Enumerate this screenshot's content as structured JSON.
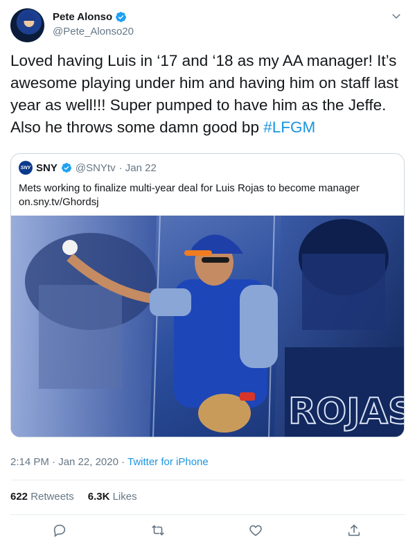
{
  "author": {
    "display_name": "Pete Alonso",
    "handle": "@Pete_Alonso20"
  },
  "tweet": {
    "text": "Loved having Luis in ‘17 and ‘18 as my AA manager! It’s awesome playing under him and having him on staff last year as well!!! Super pumped to have him as the Jeffe. Also he throws some damn good bp ",
    "hashtag": "#LFGM"
  },
  "quoted": {
    "logo_text": "SNY",
    "display_name": "SNY",
    "handle": "@SNYtv",
    "date": "· Jan 22",
    "text": "Mets working to finalize multi-year deal for Luis Rojas to become manager",
    "link": "on.sny.tv/Ghordsj",
    "image_jersey_text": "ROJAS"
  },
  "meta": {
    "time_date": "2:14 PM · Jan 22, 2020 · ",
    "source": "Twitter for iPhone"
  },
  "stats": {
    "retweets_count": "622",
    "retweets_label": "Retweets",
    "likes_count": "6.3K",
    "likes_label": "Likes"
  },
  "icons": {
    "verified": "verified-badge-icon",
    "caret": "chevron-down-icon",
    "reply": "reply-icon",
    "retweet": "retweet-icon",
    "like": "heart-icon",
    "share": "share-icon"
  },
  "colors": {
    "accent": "#1b95e0",
    "verified": "#1da1f2",
    "muted": "#657786"
  }
}
